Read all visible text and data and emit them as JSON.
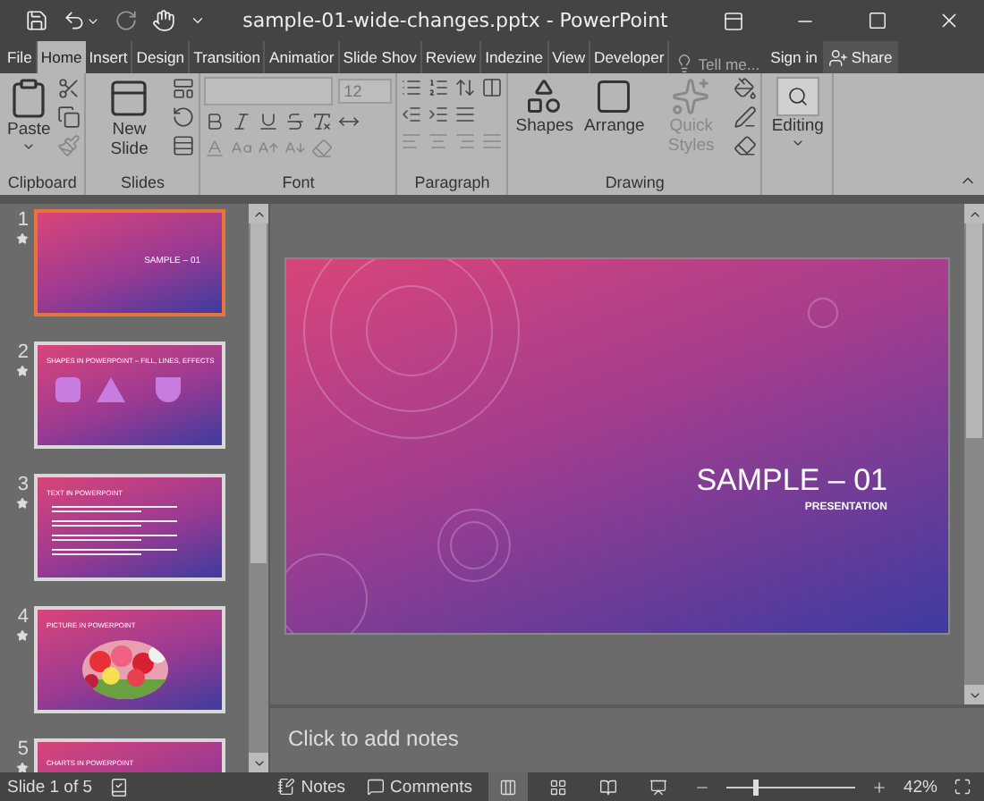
{
  "title_bar": {
    "title": "sample-01-wide-changes.pptx - PowerPoint",
    "redo_disabled": true
  },
  "tabs": [
    {
      "label": "File",
      "selected": false
    },
    {
      "label": "Home",
      "selected": true
    },
    {
      "label": "Insert",
      "selected": false
    },
    {
      "label": "Design",
      "selected": false
    },
    {
      "label": "Transition",
      "selected": false
    },
    {
      "label": "Animatior",
      "selected": false
    },
    {
      "label": "Slide Shov",
      "selected": false
    },
    {
      "label": "Review",
      "selected": false
    },
    {
      "label": "Indezine",
      "selected": false
    },
    {
      "label": "View",
      "selected": false
    },
    {
      "label": "Developer",
      "selected": false
    }
  ],
  "tell_me": "Tell me...",
  "sign_in": "Sign in",
  "share": "Share",
  "ribbon": {
    "groups": [
      {
        "kind": "clipboard",
        "label": "Clipboard",
        "buttons": [
          {
            "label": "Paste",
            "disabled": false
          }
        ]
      },
      {
        "kind": "slides",
        "label": "Slides",
        "buttons": [
          {
            "label": "New Slide",
            "disabled": false
          }
        ]
      },
      {
        "kind": "font",
        "label": "Font",
        "font_size": "12"
      },
      {
        "kind": "paragraph",
        "label": "Paragraph"
      },
      {
        "kind": "drawing",
        "label": "Drawing",
        "buttons": [
          {
            "label": "Shapes",
            "disabled": false
          },
          {
            "label": "Arrange",
            "disabled": false
          },
          {
            "label": "Quick Styles",
            "disabled": true
          }
        ]
      },
      {
        "kind": "editing",
        "buttons": [
          {
            "label": "Editing"
          }
        ]
      }
    ]
  },
  "slides": [
    {
      "number": "1",
      "selected": true,
      "kind": "title",
      "title": "SAMPLE – 01"
    },
    {
      "number": "2",
      "selected": false,
      "kind": "shapes",
      "title": "SHAPES IN POWERPOINT – FILL, LINES, EFFECTS"
    },
    {
      "number": "3",
      "selected": false,
      "kind": "bullets",
      "title": "TEXT IN POWERPOINT"
    },
    {
      "number": "4",
      "selected": false,
      "kind": "picture",
      "title": "PICTURE IN POWERPOINT"
    },
    {
      "number": "5",
      "selected": false,
      "kind": "chart",
      "title": "CHARTS IN POWERPOINT"
    }
  ],
  "slide": {
    "title": "SAMPLE – 01",
    "subtitle": "PRESENTATION"
  },
  "notes": {
    "placeholder": "Click to add notes"
  },
  "status_bar": {
    "slide_info": "Slide 1 of 5",
    "notes": "Notes",
    "comments": "Comments",
    "views": [
      {
        "selected": true
      },
      {
        "selected": false
      },
      {
        "selected": false
      },
      {
        "selected": false
      }
    ],
    "zoom": {
      "level": 0.22,
      "reading": "42%"
    }
  }
}
